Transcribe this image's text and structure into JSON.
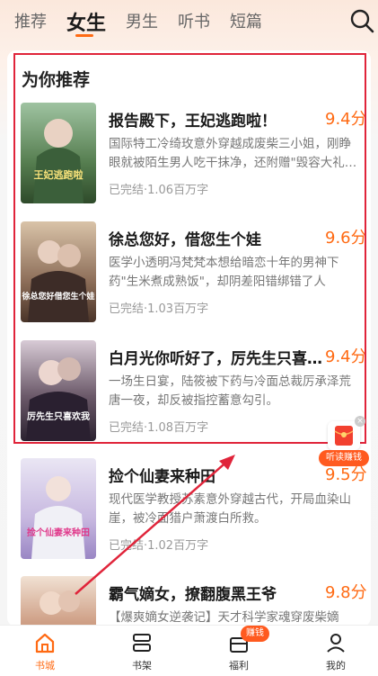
{
  "tabs": [
    {
      "label": "推荐",
      "active": false
    },
    {
      "label": "女生",
      "active": true
    },
    {
      "label": "男生",
      "active": false
    },
    {
      "label": "听书",
      "active": false
    },
    {
      "label": "短篇",
      "active": false
    }
  ],
  "section": {
    "title": "为你推荐"
  },
  "books": [
    {
      "title": "报告殿下，王妃逃跑啦！",
      "score": "9.4分",
      "desc": "国际特工冷绮玫意外穿越成废柴三小姐，刚睁眼就被陌生男人吃干抹净，还附赠\"毁容大礼…",
      "meta": "已完结·1.06百万字",
      "cover_text": "王妃逃跑啦"
    },
    {
      "title": "徐总您好，借您生个娃",
      "score": "9.6分",
      "desc": "医学小透明冯梵梵本想给暗恋十年的男神下药\"生米煮成熟饭\"，却阴差阳错绑错了人——…",
      "meta": "已完结·1.03百万字",
      "cover_text": "徐总您好借您生个娃"
    },
    {
      "title": "白月光你听好了，厉先生只喜…",
      "score": "9.4分",
      "desc": "一场生日宴，陆筱被下药与冷面总裁厉承泽荒唐一夜，却反被指控蓄意勾引。",
      "meta": "已完结·1.08百万字",
      "cover_text": "厉先生只喜欢我"
    },
    {
      "title": "捡个仙妻来种田",
      "score": "9.5分",
      "desc": "现代医学教授苏素意外穿越古代，开局血染山崖，被冷面猎户萧渡白所救。",
      "meta": "已完结·1.02百万字",
      "cover_text": "捡个仙妻来种田"
    },
    {
      "title": "霸气嫡女，撩翻腹黑王爷",
      "score": "9.8分",
      "desc": "【爆爽嫡女逆袭记】天才科学家魂穿废柴嫡",
      "meta": "",
      "cover_text": ""
    }
  ],
  "bonus": {
    "label": "听读赚钱",
    "close": "×"
  },
  "bottom_nav": [
    {
      "label": "书城",
      "active": true
    },
    {
      "label": "书架",
      "active": false
    },
    {
      "label": "福利",
      "active": false,
      "badge": "赚钱"
    },
    {
      "label": "我的",
      "active": false
    }
  ],
  "colors": {
    "accent": "#ff6a13",
    "highlight": "#e0243a"
  }
}
